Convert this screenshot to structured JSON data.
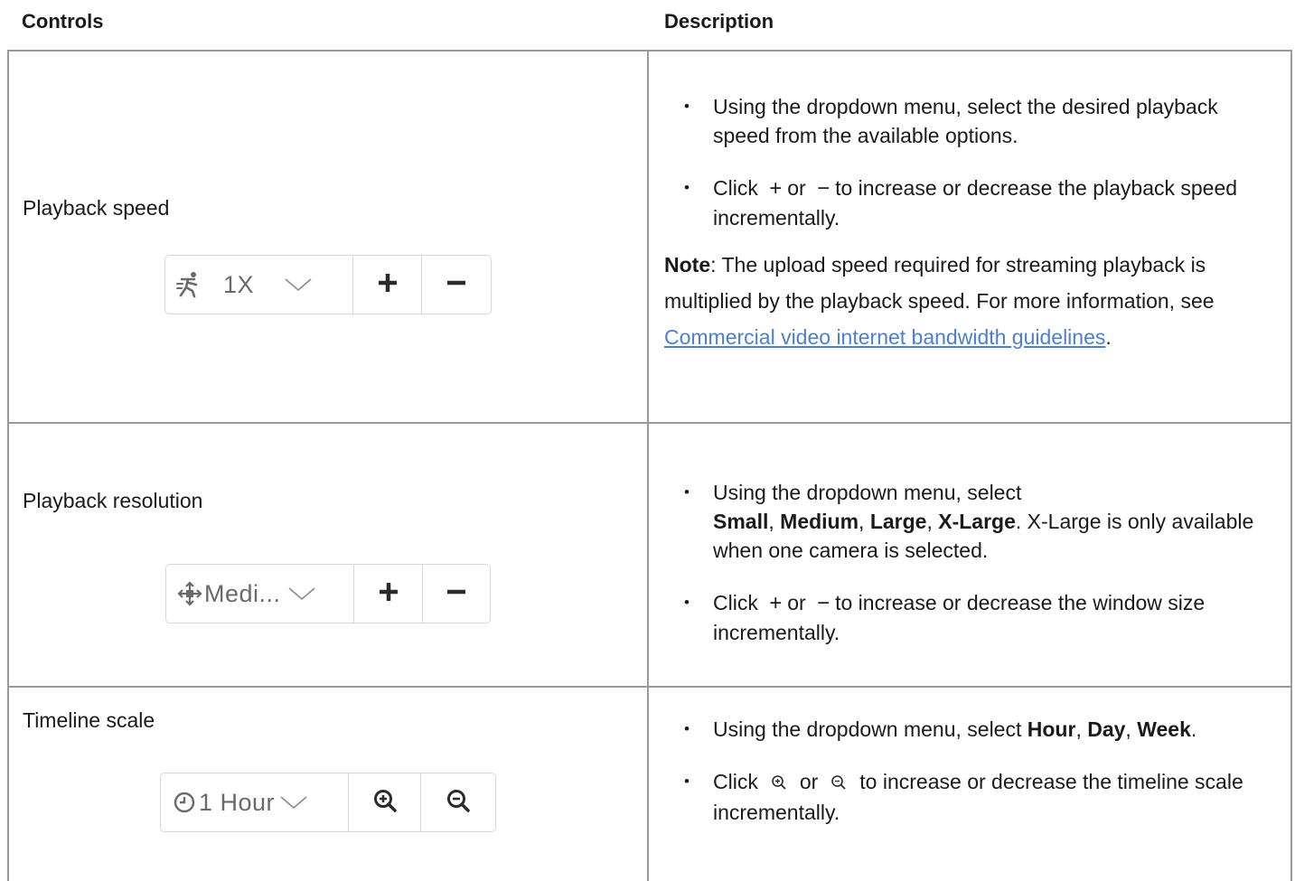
{
  "headers": {
    "controls": "Controls",
    "description": "Description"
  },
  "rows": [
    {
      "label": "Playback speed",
      "widget": {
        "icon": "running-person-icon",
        "value": "1X",
        "chevron": "chevron-down-icon",
        "increase": "plus-icon",
        "decrease": "minus-icon"
      },
      "bullets": [
        {
          "text": "Using the dropdown menu, select the desired playback speed from the available options."
        },
        {
          "pre": "Click",
          "plus": "+",
          "or": "or",
          "minus": "−",
          "post": "to increase or decrease the playback speed incrementally."
        }
      ],
      "note": {
        "label": "Note",
        "text": ": The upload speed required for streaming playback is multiplied by the playback speed. For more information, see ",
        "link": "Commercial video internet bandwidth guidelines",
        "end": "."
      }
    },
    {
      "label": "Playback resolution",
      "widget": {
        "icon": "move-arrows-icon",
        "value": "Medi...",
        "chevron": "chevron-down-icon",
        "increase": "plus-icon",
        "decrease": "minus-icon"
      },
      "bullets": [
        {
          "pre": "Using the dropdown menu, select",
          "opt1": "Small",
          "sep": ",",
          "opt2": "Medium",
          "opt3": "Large",
          "opt4": "X-Large",
          "post": ". X-Large is only available when one camera is selected."
        },
        {
          "pre": "Click",
          "plus": "+",
          "or": "or",
          "minus": "−",
          "post": "to increase or decrease the window size incrementally."
        }
      ]
    },
    {
      "label": "Timeline scale",
      "widget": {
        "icon": "clock-icon",
        "value": "1 Hour",
        "chevron": "chevron-down-icon",
        "increase": "zoom-in-icon",
        "decrease": "zoom-out-icon"
      },
      "bullets": [
        {
          "pre": "Using the dropdown menu, select",
          "opt1": "Hour",
          "opt2": "Day",
          "opt3": "Week",
          "end": "."
        },
        {
          "pre": "Click",
          "or": "or",
          "post": "to increase or decrease the timeline scale incrementally."
        }
      ]
    }
  ]
}
